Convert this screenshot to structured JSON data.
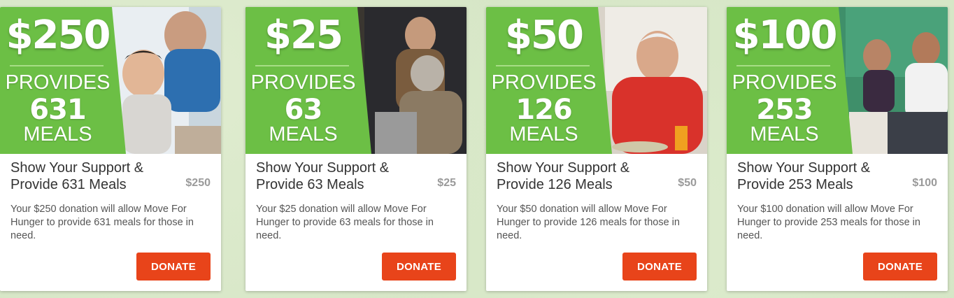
{
  "cards": [
    {
      "amount": "$25",
      "provides": "PROVIDES",
      "meals_count": "63",
      "meals_word": "MEALS",
      "title": "Show Your Support & Provide 63 Meals",
      "price": "$25",
      "description": "Your $25 donation will allow Move For Hunger to provide 63 meals for those in need.",
      "button_label": "DONATE"
    },
    {
      "amount": "$50",
      "provides": "PROVIDES",
      "meals_count": "126",
      "meals_word": "MEALS",
      "title": "Show Your Support & Provide 126 Meals",
      "price": "$50",
      "description": "Your $50 donation will allow Move For Hunger to provide 126 meals for those in need.",
      "button_label": "DONATE"
    },
    {
      "amount": "$100",
      "provides": "PROVIDES",
      "meals_count": "253",
      "meals_word": "MEALS",
      "title": "Show Your Support & Provide 253 Meals",
      "price": "$100",
      "description": "Your $100 donation will allow Move For Hunger to provide 253 meals for those in need.",
      "button_label": "DONATE"
    },
    {
      "amount": "$250",
      "provides": "PROVIDES",
      "meals_count": "631",
      "meals_word": "MEALS",
      "title": "Show Your Support & Provide 631 Meals",
      "price": "$250",
      "description": "Your $250 donation will allow Move For Hunger to provide 631 meals for those in need.",
      "button_label": "DONATE"
    }
  ],
  "colors": {
    "brand_green": "#6cbf45",
    "donate_orange": "#e8441a",
    "price_gray": "#9a9a9a",
    "page_background": "#d6e6c6"
  }
}
